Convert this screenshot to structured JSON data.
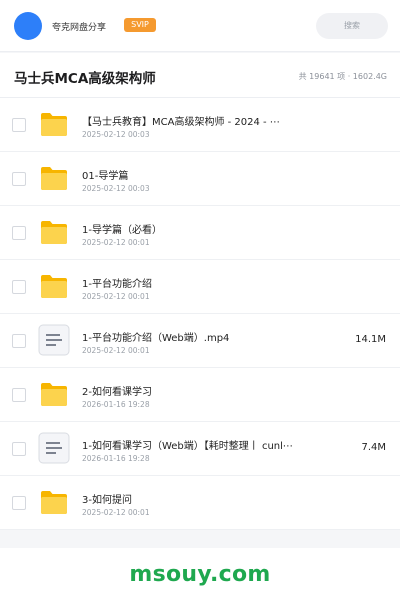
{
  "header": {
    "share_name": "夸克网盘分享",
    "badge": "SVIP",
    "search_placeholder": "搜索"
  },
  "folder": {
    "title": "马士兵MCA高级架构师",
    "stats": "共 19641 项 · 1602.4G"
  },
  "colors": {
    "accent": "#2d7ff9",
    "badge": "#f59a2f",
    "brand": "#1fa84f",
    "folder_yellow": "#fbc31d"
  },
  "files": [
    {
      "name": "【马士兵教育】MCA高级架构师 - 2024 - ⋯",
      "date": "2025-02-12 00:03",
      "size": "",
      "icon": "folder-icon"
    },
    {
      "name": "01-导学篇",
      "date": "2025-02-12 00:03",
      "size": "",
      "icon": "folder-icon"
    },
    {
      "name": "1-导学篇（必看）",
      "date": "2025-02-12 00:01",
      "size": "",
      "icon": "folder-icon"
    },
    {
      "name": "1-平台功能介绍",
      "date": "2025-02-12 00:01",
      "size": "",
      "icon": "folder-icon"
    },
    {
      "name": "1-平台功能介绍（Web端）.mp4",
      "date": "2025-02-12 00:01",
      "size": "14.1M",
      "icon": "document-icon"
    },
    {
      "name": "2-如何看课学习",
      "date": "2026-01-16 19:28",
      "size": "",
      "icon": "folder-icon"
    },
    {
      "name": "1-如何看课学习（Web端）【耗时整理丨 cunl⋯",
      "date": "2026-01-16 19:28",
      "size": "7.4M",
      "icon": "document-icon"
    },
    {
      "name": "3-如何提问",
      "date": "2025-02-12 00:01",
      "size": "",
      "icon": "folder-icon"
    }
  ],
  "footer": {
    "brand": "msouy.com"
  }
}
